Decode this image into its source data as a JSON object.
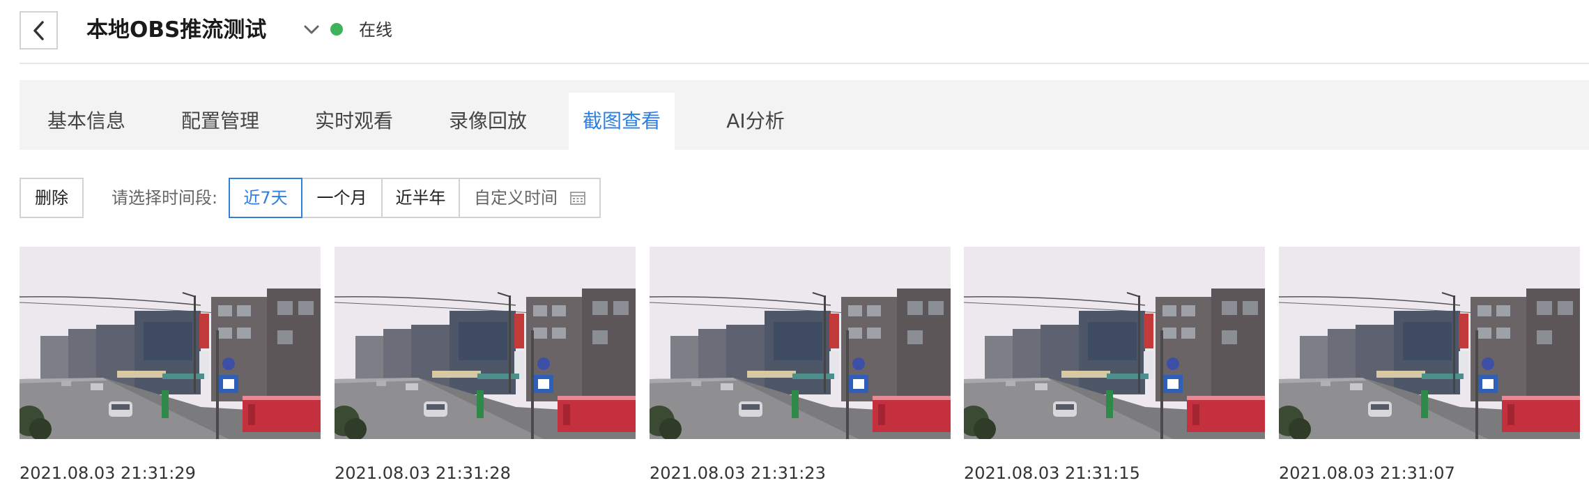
{
  "header": {
    "device_title": "本地OBS推流测试",
    "status_text": "在线",
    "status_color": "#3fb25c",
    "back_icon": "chevron-left-icon",
    "dropdown_icon": "chevron-down-icon"
  },
  "tabs": [
    {
      "label": "基本信息",
      "active": false
    },
    {
      "label": "配置管理",
      "active": false
    },
    {
      "label": "实时观看",
      "active": false
    },
    {
      "label": "录像回放",
      "active": false
    },
    {
      "label": "截图查看",
      "active": true
    },
    {
      "label": "AI分析",
      "active": false
    }
  ],
  "toolbar": {
    "delete_label": "删除",
    "range_label": "请选择时间段:",
    "ranges": [
      {
        "label": "近7天",
        "active": true
      },
      {
        "label": "一个月",
        "active": false
      },
      {
        "label": "近半年",
        "active": false
      }
    ],
    "custom_label": "自定义时间",
    "custom_icon": "calendar-icon"
  },
  "snapshots": [
    {
      "time": "2021.08.03 21:31:29"
    },
    {
      "time": "2021.08.03 21:31:28"
    },
    {
      "time": "2021.08.03 21:31:23"
    },
    {
      "time": "2021.08.03 21:31:15"
    },
    {
      "time": "2021.08.03 21:31:07"
    }
  ],
  "colors": {
    "accent": "#2e7fe0",
    "online": "#3fb25c",
    "tab_bar_bg": "#f3f3f3"
  }
}
